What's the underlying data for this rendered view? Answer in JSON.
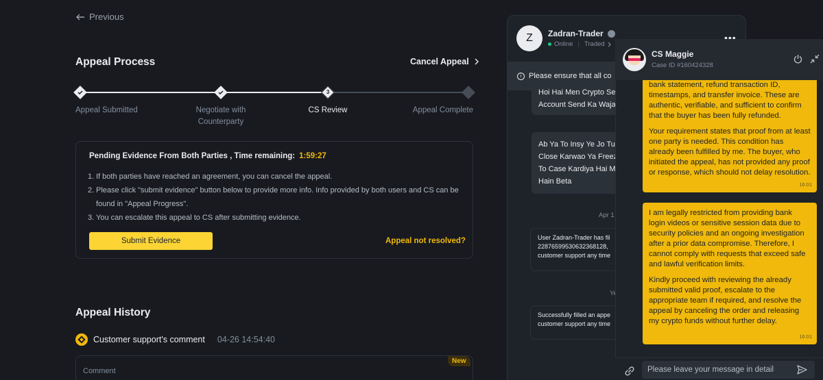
{
  "nav": {
    "previous": "Previous"
  },
  "appeal": {
    "title": "Appeal Process",
    "cancel": "Cancel Appeal",
    "steps": [
      {
        "line1": "Appeal Submitted",
        "line2": "",
        "state": "done"
      },
      {
        "line1": "Negotiate with",
        "line2": "Counterparty",
        "state": "done"
      },
      {
        "line1": "CS Review",
        "line2": "",
        "state": "current",
        "num": "3"
      },
      {
        "line1": "Appeal Complete",
        "line2": "",
        "state": "todo"
      }
    ],
    "pending": "Pending Evidence From Both Parties , Time remaining:",
    "timer": "1:59:27",
    "notes": [
      {
        "n": "1.",
        "text": "If both parties have reached an agreement, you can cancel the appeal."
      },
      {
        "n": "2.",
        "text": "Please click \"submit evidence\" button below to provide more info. Info provided by both users and CS can be found in \"Appeal Progress\"."
      },
      {
        "n": "3.",
        "text": "You can escalate this appeal to CS after submitting evidence."
      }
    ],
    "submit": "Submit Evidence",
    "unresolved": "Appeal not resolved?"
  },
  "history": {
    "title": "Appeal History",
    "entry_label": "Customer support's comment",
    "entry_time": "04-26 14:54:40",
    "comment_label": "Comment",
    "badge": "New"
  },
  "trader_chat": {
    "avatar_letter": "Z",
    "name": "Zadran-Trader",
    "status": "Online",
    "traded": "Traded",
    "more": "•••",
    "notice": "Please ensure that all co",
    "msg1_l1": "Hoi Hai Men Crypto Se",
    "msg1_l2": "Account Send Ka Waja",
    "msg2_l1": "Ab Ya To Insy Ye Jo Tu",
    "msg2_l2": "Close Karwao Ya Freez",
    "msg2_l3": "To Case Kardiya Hai M",
    "msg2_l4": "Hain Beta",
    "date1": "Apr 1",
    "sys1_l1": "User Zadran-Trader has fil",
    "sys1_l2": "22876599530632368128,",
    "sys1_l3": "customer support any time",
    "date2": "Ye",
    "sys2_l1": "Successfully filled an appe",
    "sys2_l2": "customer support any time"
  },
  "cs_chat": {
    "name": "CS Maggie",
    "case_id": "Case ID #160424328",
    "msg1_p1": "bank statement, refund transaction ID, timestamps, and transfer invoice. These are authentic, verifiable, and sufficient to confirm that the buyer has been fully refunded.",
    "msg1_p2": "Your requirement states that proof from at least one party is needed. This condition has already been fulfilled by me. The buyer, who initiated the appeal, has not provided any proof or response, which should not delay resolution.",
    "msg1_time": "16:01",
    "msg2_p1": "I am legally restricted from providing bank login videos or sensitive session data due to security policies and an ongoing investigation after a prior data compromise. Therefore, I cannot comply with requests that exceed safe and lawful verification limits.",
    "msg2_p2": "Kindly proceed with reviewing the already submitted valid proof, escalate to the appropriate team if required, and resolve the appeal by canceling the order and releasing my crypto funds without further delay.",
    "msg2_time": "16:01",
    "input_placeholder": "Please leave your message in detail"
  },
  "icons": {
    "back": "arrow-left-icon",
    "cancel": "chevron-right-icon",
    "power": "power-icon",
    "shrink": "shrink-icon",
    "link": "link-icon",
    "send": "send-icon"
  },
  "colors": {
    "accent": "#f0b90b",
    "button": "#fcd535",
    "bg": "#181a20",
    "panel": "#1e2329"
  }
}
